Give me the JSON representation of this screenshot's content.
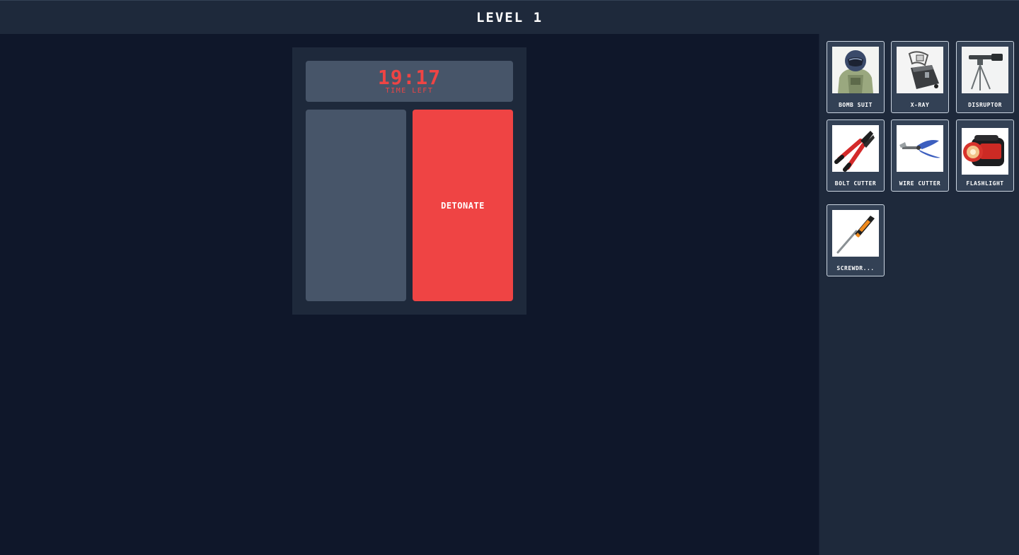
{
  "header": {
    "title": "LEVEL 1"
  },
  "bomb": {
    "timer": "19:17",
    "timer_label": "TIME LEFT",
    "detonate_label": "DETONATE"
  },
  "tools": [
    {
      "label": "BOMB SUIT",
      "icon": "bomb-suit-icon"
    },
    {
      "label": "X-RAY",
      "icon": "x-ray-icon"
    },
    {
      "label": "DISRUPTOR",
      "icon": "disruptor-icon"
    },
    {
      "label": "BOLT CUTTER",
      "icon": "bolt-cutter-icon"
    },
    {
      "label": "WIRE CUTTER",
      "icon": "wire-cutter-icon"
    },
    {
      "label": "FLASHLIGHT",
      "icon": "flashlight-icon"
    },
    {
      "label": "SCREWDR...",
      "icon": "screwdriver-icon"
    }
  ],
  "colors": {
    "background": "#0f172a",
    "panel": "#1e293b",
    "slot": "#475569",
    "danger": "#ef4444"
  }
}
